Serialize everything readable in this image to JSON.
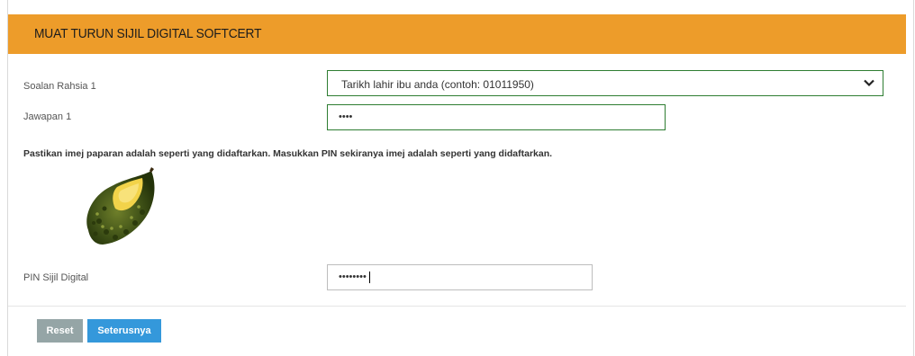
{
  "header": {
    "title": "MUAT TURUN SIJIL DIGITAL SOFTCERT"
  },
  "form": {
    "secret_question_label": "Soalan Rahsia 1",
    "secret_question_value": "Tarikh lahir ibu anda (contoh: 01011950)",
    "answer_label": "Jawapan 1",
    "answer_value": "••••",
    "notice": "Pastikan imej paparan adalah seperti yang didaftarkan. Masukkan PIN sekiranya imej adalah seperti yang didaftarkan.",
    "pin_label": "PIN Sijil Digital",
    "pin_value": "••••••••"
  },
  "buttons": {
    "reset": "Reset",
    "next": "Seterusnya"
  },
  "colors": {
    "header": "#ed9c2a",
    "reset": "#95a5a6",
    "next": "#3498db",
    "field_border_active": "#2e7d32"
  },
  "image": {
    "icon": "durian-image"
  }
}
